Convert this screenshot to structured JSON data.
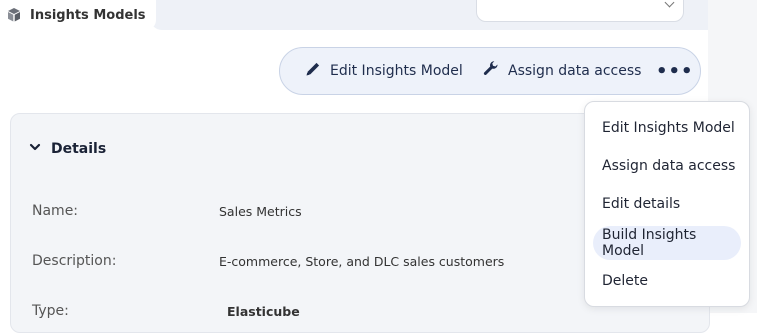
{
  "tab": {
    "label": "Insights Models",
    "icon": "cube-icon"
  },
  "toolbar": {
    "edit_label": "Edit Insights Model",
    "assign_label": "Assign data access",
    "more_label": "•••"
  },
  "details": {
    "toggle_label": "Details",
    "rows": [
      {
        "label": "Name:",
        "value": "Sales Metrics"
      },
      {
        "label": "Description:",
        "value": "E-commerce, Store, and DLC sales customers"
      },
      {
        "label": "Type:",
        "value": "Elasticube"
      }
    ]
  },
  "menu": {
    "items": [
      {
        "label": "Edit Insights Model"
      },
      {
        "label": "Assign data access"
      },
      {
        "label": "Edit details"
      },
      {
        "label": "Build Insights Model",
        "active": true
      },
      {
        "label": "Delete"
      }
    ]
  },
  "colors": {
    "accent": "#1f2d4d",
    "toolbar_bg": "#eef2fa",
    "menu_active": "#e9eefb",
    "panel_bg": "#f3f5f8"
  }
}
